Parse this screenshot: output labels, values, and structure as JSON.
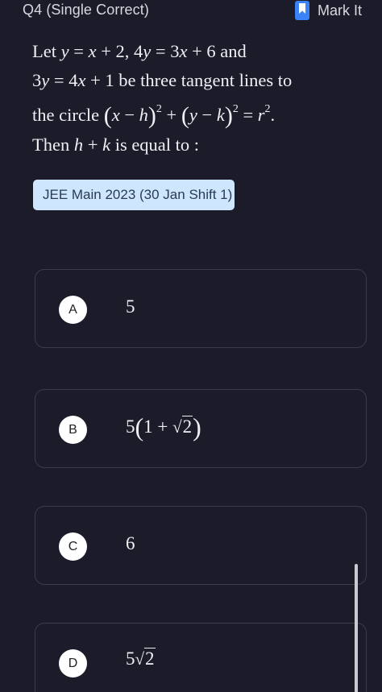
{
  "header": {
    "question_label": "Q4 (Single Correct)",
    "mark_label": "Mark It"
  },
  "question": {
    "w_let": "Let",
    "w_and": "and",
    "w_be3": "be three tangent lines to",
    "w_thecircle": "the circle",
    "w_then": "Then",
    "w_isequal": "is equal to :"
  },
  "tag": "JEE Main 2023 (30 Jan Shift 1)",
  "options": [
    {
      "letter": "A",
      "value": "5"
    },
    {
      "letter": "B",
      "value": "5(1 + √2)"
    },
    {
      "letter": "C",
      "value": "6"
    },
    {
      "letter": "D",
      "value": "5√2"
    }
  ]
}
